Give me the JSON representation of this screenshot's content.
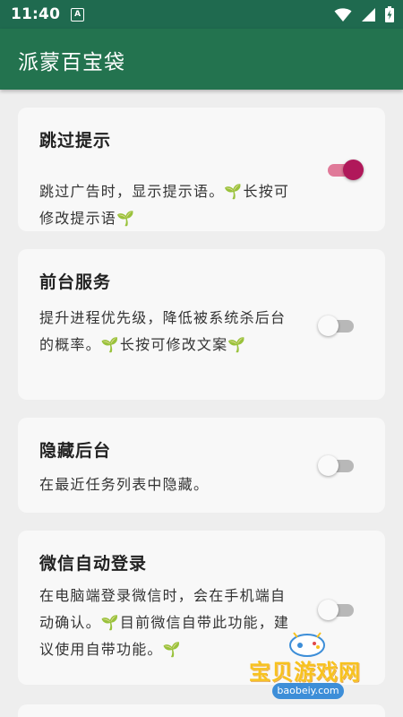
{
  "status_bar": {
    "time": "11:40",
    "notification_icon": "A",
    "icons": [
      "wifi-icon",
      "signal-icon",
      "battery-charging-icon"
    ]
  },
  "app_bar": {
    "title": "派蒙百宝袋"
  },
  "colors": {
    "status_bar": "#1f6a4f",
    "app_bar": "#23734f",
    "toggle_on_thumb": "#b0185a",
    "toggle_on_track": "#e07a99",
    "card_background": "#f8f8f8",
    "page_background": "#eeeeee"
  },
  "settings": [
    {
      "title": "跳过提示",
      "description": "跳过广告时，显示提示语。🌱长按可修改提示语🌱",
      "enabled": true
    },
    {
      "title": "前台服务",
      "description": "提升进程优先级，降低被系统杀后台的概率。🌱长按可修改文案🌱",
      "enabled": false
    },
    {
      "title": "隐藏后台",
      "description": "在最近任务列表中隐藏。",
      "enabled": false
    },
    {
      "title": "微信自动登录",
      "description": "在电脑端登录微信时，会在手机端自动确认。🌱目前微信自带此功能，建议使用自带功能。🌱",
      "enabled": false
    }
  ],
  "watermark": {
    "brand": "宝贝游戏网",
    "domain": "baobeiy.com"
  }
}
